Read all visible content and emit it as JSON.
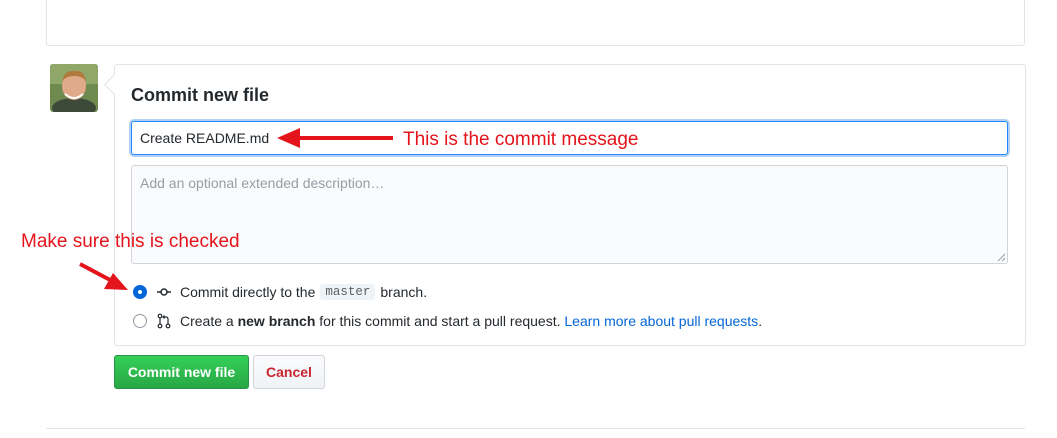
{
  "form": {
    "heading": "Commit new file",
    "commit_message": "Create README.md",
    "description_placeholder": "Add an optional extended description…"
  },
  "options": {
    "direct": {
      "prefix": "Commit directly to the",
      "branch": "master",
      "suffix": "branch.",
      "checked": true
    },
    "new_branch": {
      "prefix": "Create a",
      "bold": "new branch",
      "middle": "for this commit and start a pull request.",
      "link": "Learn more about pull requests",
      "end": ".",
      "checked": false
    }
  },
  "buttons": {
    "commit": "Commit new file",
    "cancel": "Cancel"
  },
  "annotations": {
    "message_note": "This is the commit message",
    "check_note": "Make sure this is checked"
  },
  "colors": {
    "annotation": "#e3141b",
    "primary_button": "#28a745",
    "link": "#0366d6",
    "danger": "#cb2431"
  },
  "icons": {
    "avatar": "user-avatar",
    "direct_commit": "git-commit-icon",
    "new_branch": "git-pull-request-icon"
  }
}
